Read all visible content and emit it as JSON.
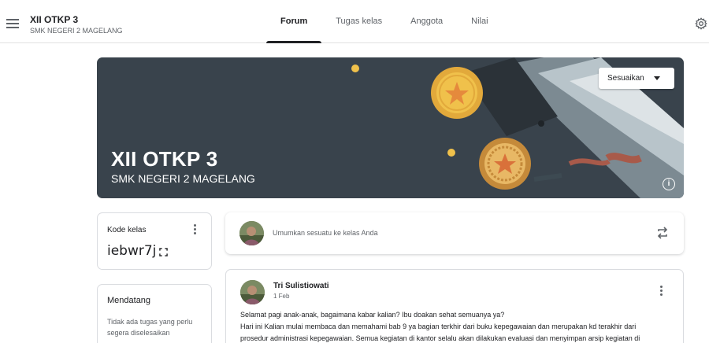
{
  "header": {
    "class_name": "XII OTKP 3",
    "school": "SMK NEGERI 2 MAGELANG",
    "tabs": [
      {
        "label": "Forum",
        "active": true
      },
      {
        "label": "Tugas kelas",
        "active": false
      },
      {
        "label": "Anggota",
        "active": false
      },
      {
        "label": "Nilai",
        "active": false
      }
    ],
    "icons": {
      "menu": "hamburger-menu-icon",
      "settings": "gear-icon"
    }
  },
  "banner": {
    "title": "XII OTKP 3",
    "subtitle": "SMK NEGERI 2 MAGELANG",
    "customize_label": "Sesuaikan",
    "background_color": "#39434c"
  },
  "class_code": {
    "label": "Kode kelas",
    "value": "iebwr7j"
  },
  "upcoming": {
    "title": "Mendatang",
    "empty_text": "Tidak ada tugas yang perlu segera diselesaikan"
  },
  "announce": {
    "placeholder": "Umumkan sesuatu ke kelas Anda"
  },
  "post": {
    "author": "Tri Sulistiowati",
    "date": "1 Feb",
    "lines": [
      "Selamat pagi anak-anak, bagaimana kabar kalian? Ibu doakan sehat semuanya ya?",
      "Hari ini Kalian mulai membaca dan memahami bab 9 ya bagian terkhir dari buku kepegawaian dan merupakan kd terakhir dari",
      "prosedur administrasi kepegawaian. Semua kegiatan di kantor selalu akan dilakukan evaluasi dan menyimpan arsip kegiatan di"
    ]
  }
}
